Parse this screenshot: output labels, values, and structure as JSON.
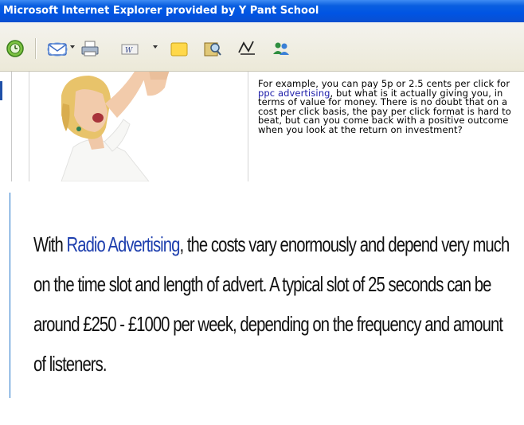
{
  "window": {
    "title": "Microsoft Internet Explorer provided by Y Pant School"
  },
  "toolbar": {
    "icons": [
      "history-icon",
      "mail-icon",
      "print-icon",
      "word-edit-icon",
      "notes-icon",
      "research-icon",
      "messenger-icon",
      "contacts-icon"
    ]
  },
  "article_top": {
    "text_before_link": "For example, you can pay 5p or 2.5 cents per click for ",
    "link_text": "ppc advertising",
    "text_after_link": ", but what is it actually giving you, in terms of value for money. There is no doubt that on a cost per click basis, the pay per click format is hard to beat, but can you come back with a positive outcome when you look at the return on investment?"
  },
  "article_bottom": {
    "text_before_link": "With ",
    "link_text": "Radio Advertising",
    "text_after_link": ", the costs vary enormously and depend very much on the time slot and length of advert. A typical slot of 25 seconds can be around £250 - £1000 per week, depending on the frequency and amount of listeners."
  },
  "colors": {
    "title_bar": "#0054e3",
    "link": "#1a1aa8",
    "toolbar_bg": "#ece9d8"
  }
}
